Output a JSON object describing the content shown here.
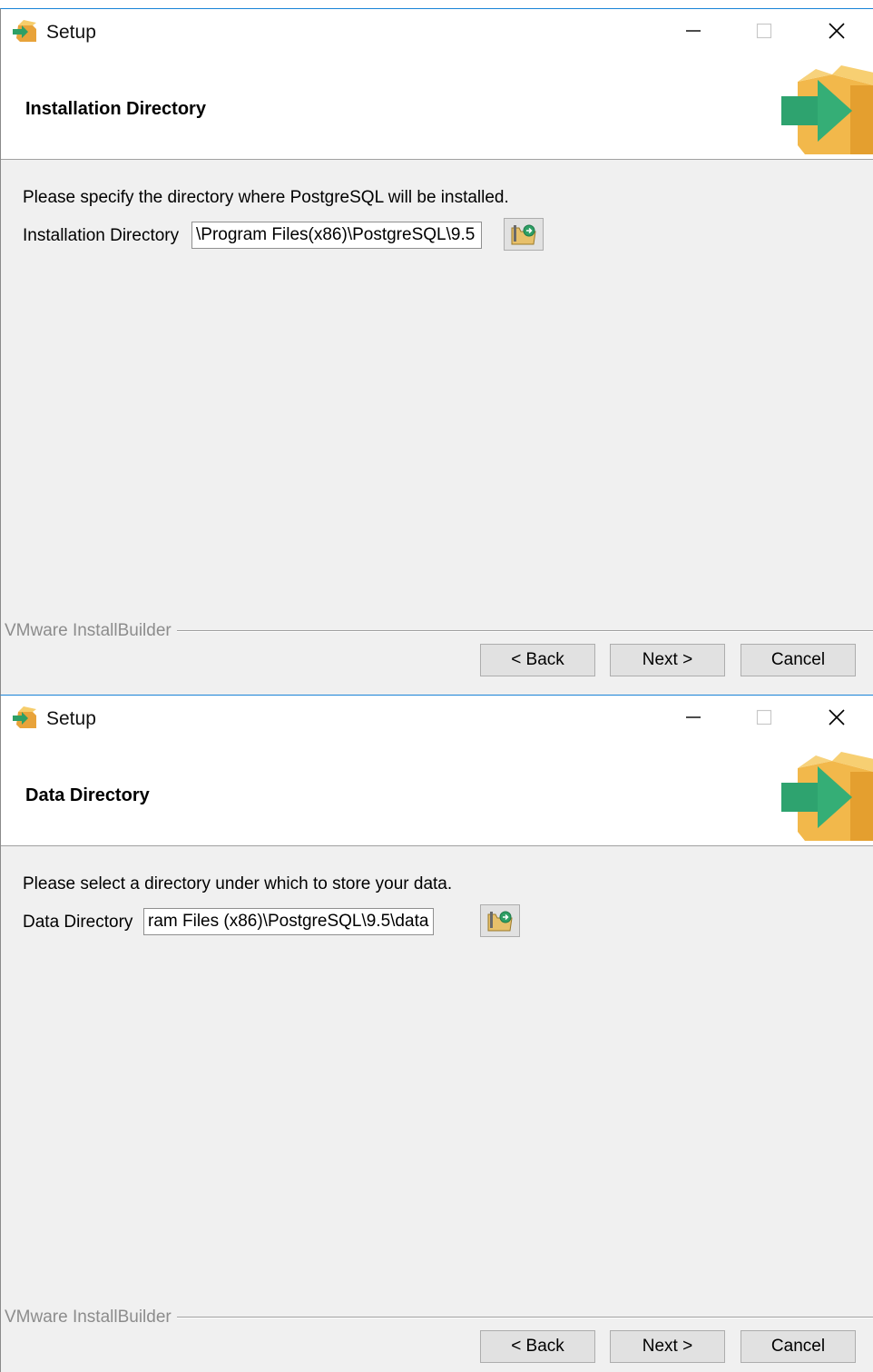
{
  "screens": [
    {
      "window_title": "Setup",
      "header_title": "Installation Directory",
      "instruction": "Please specify the directory where PostgreSQL will be installed.",
      "field_label": "Installation Directory",
      "field_value": "\\Program Files(x86)\\PostgreSQL\\9.5",
      "branding": "VMware InstallBuilder",
      "buttons": {
        "back": "< Back",
        "next": "Next >",
        "cancel": "Cancel"
      }
    },
    {
      "window_title": "Setup",
      "header_title": "Data Directory",
      "instruction": "Please select a directory under which to store your data.",
      "field_label": "Data Directory",
      "field_value": "ram Files (x86)\\PostgreSQL\\9.5\\data",
      "branding": "VMware InstallBuilder",
      "buttons": {
        "back": "< Back",
        "next": "Next >",
        "cancel": "Cancel"
      }
    }
  ],
  "icons": {
    "app": "setup-box-icon",
    "minimize": "minimize-icon",
    "maximize": "maximize-icon",
    "close": "close-icon",
    "logo": "installer-box-arrow-logo",
    "browse": "folder-browse-icon"
  },
  "colors": {
    "window_border": "#1883d7",
    "body_bg": "#f0f0f0",
    "header_bg": "#ffffff",
    "button_bg": "#e1e1e1",
    "logo_box": "#f2b84b",
    "logo_arrow": "#2ea36f"
  }
}
